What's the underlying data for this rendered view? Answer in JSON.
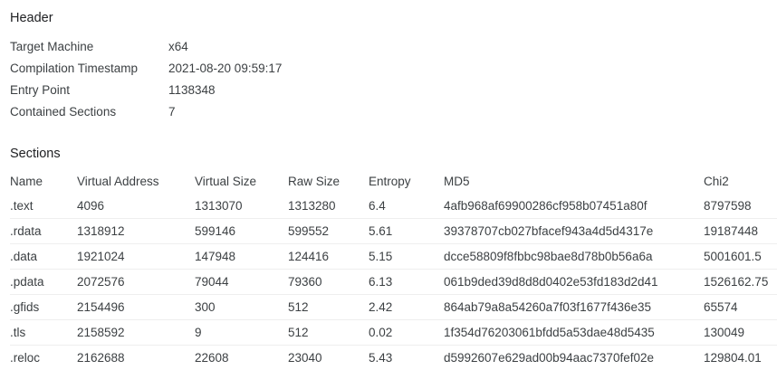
{
  "header": {
    "title": "Header",
    "fields": [
      {
        "label": "Target Machine",
        "value": "x64"
      },
      {
        "label": "Compilation Timestamp",
        "value": "2021-08-20 09:59:17"
      },
      {
        "label": "Entry Point",
        "value": "1138348"
      },
      {
        "label": "Contained Sections",
        "value": "7"
      }
    ]
  },
  "sections": {
    "title": "Sections",
    "columns": [
      "Name",
      "Virtual Address",
      "Virtual Size",
      "Raw Size",
      "Entropy",
      "MD5",
      "Chi2"
    ],
    "rows": [
      [
        ".text",
        "4096",
        "1313070",
        "1313280",
        "6.4",
        "4afb968af69900286cf958b07451a80f",
        "8797598"
      ],
      [
        ".rdata",
        "1318912",
        "599146",
        "599552",
        "5.61",
        "39378707cb027bfacef943a4d5d4317e",
        "19187448"
      ],
      [
        ".data",
        "1921024",
        "147948",
        "124416",
        "5.15",
        "dcce58809f8fbbc98bae8d78b0b56a6a",
        "5001601.5"
      ],
      [
        ".pdata",
        "2072576",
        "79044",
        "79360",
        "6.13",
        "061b9ded39d8d8d0402e53fd183d2d41",
        "1526162.75"
      ],
      [
        ".gfids",
        "2154496",
        "300",
        "512",
        "2.42",
        "864ab79a8a54260a7f03f1677f436e35",
        "65574"
      ],
      [
        ".tls",
        "2158592",
        "9",
        "512",
        "0.02",
        "1f354d76203061bfdd5a53dae48d5435",
        "130049"
      ],
      [
        ".reloc",
        "2162688",
        "22608",
        "23040",
        "5.43",
        "d5992607e629ad00b94aac7370fef02e",
        "129804.01"
      ]
    ]
  }
}
